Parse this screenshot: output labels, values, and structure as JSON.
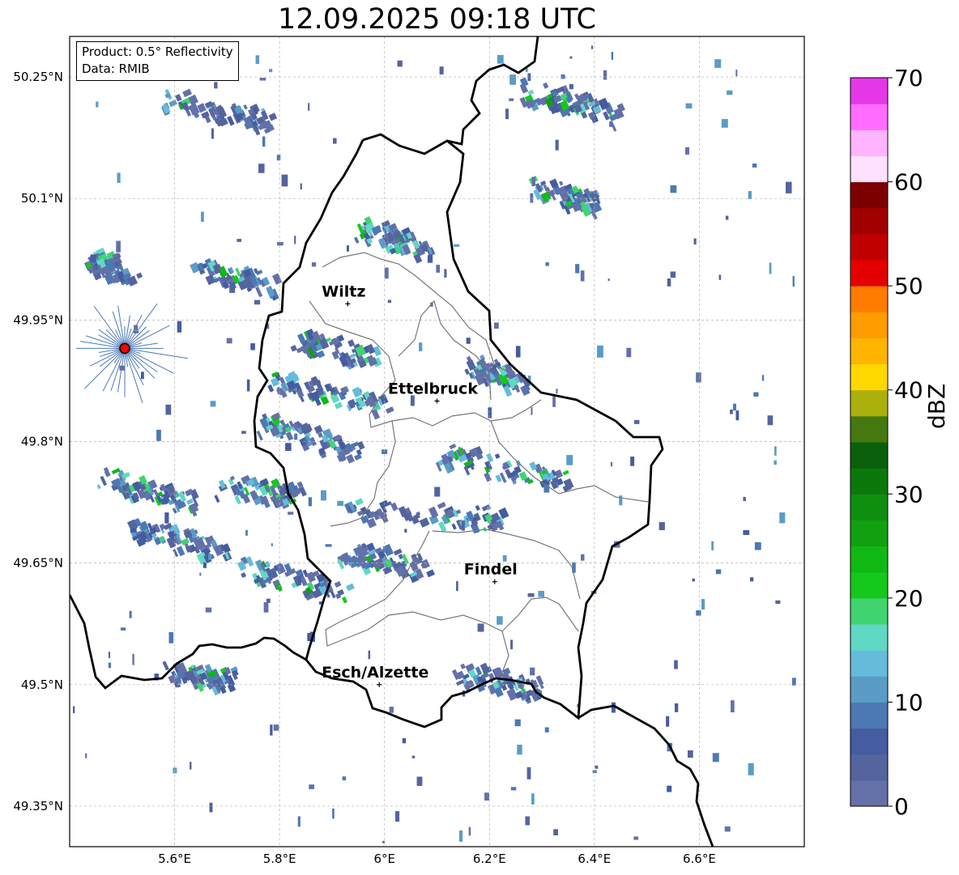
{
  "title": "12.09.2025 09:18 UTC",
  "info_box": {
    "product": "Product: 0.5° Reflectivity",
    "data": "Data: RMIB"
  },
  "map": {
    "lon_range": [
      5.4,
      6.8
    ],
    "lat_range": [
      49.3,
      50.3
    ],
    "lat_ticks": [
      {
        "value": 50.25,
        "label": "50.25°N"
      },
      {
        "value": 50.1,
        "label": "50.1°N"
      },
      {
        "value": 49.95,
        "label": "49.95°N"
      },
      {
        "value": 49.8,
        "label": "49.8°N"
      },
      {
        "value": 49.65,
        "label": "49.65°N"
      },
      {
        "value": 49.5,
        "label": "49.5°N"
      },
      {
        "value": 49.35,
        "label": "49.35°N"
      }
    ],
    "lon_ticks": [
      {
        "value": 5.6,
        "label": "5.6°E"
      },
      {
        "value": 5.8,
        "label": "5.8°E"
      },
      {
        "value": 6.0,
        "label": "6°E"
      },
      {
        "value": 6.2,
        "label": "6.2°E"
      },
      {
        "value": 6.4,
        "label": "6.4°E"
      },
      {
        "value": 6.6,
        "label": "6.6°E"
      }
    ],
    "cities": [
      {
        "name": "Wiltz",
        "lon": 5.93,
        "lat": 49.97
      },
      {
        "name": "Ettelbruck",
        "lon": 6.1,
        "lat": 49.85
      },
      {
        "name": "Findel",
        "lon": 6.21,
        "lat": 49.627
      },
      {
        "name": "Esch/Alzette",
        "lon": 5.99,
        "lat": 49.5
      }
    ],
    "radar_site": {
      "lon": 5.505,
      "lat": 49.915,
      "color": "#ff0000"
    }
  },
  "colorbar": {
    "label": "dBZ",
    "min": 0,
    "max": 70,
    "tick_labels": [
      "0",
      "10",
      "20",
      "30",
      "40",
      "50",
      "60",
      "70"
    ],
    "colors": [
      "#6470a8",
      "#54649e",
      "#445ca0",
      "#4c78b4",
      "#5a9cc6",
      "#64bcda",
      "#60d8c4",
      "#40d470",
      "#14c81c",
      "#10b814",
      "#10a010",
      "#0e8e0e",
      "#0c780c",
      "#0a600a",
      "#447810",
      "#acb00c",
      "#ffd800",
      "#ffb400",
      "#ff9c00",
      "#ff7c00",
      "#e40000",
      "#c00000",
      "#a00000",
      "#7c0000",
      "#ffe0ff",
      "#ffb4ff",
      "#ff6cff",
      "#e438e8"
    ]
  }
}
